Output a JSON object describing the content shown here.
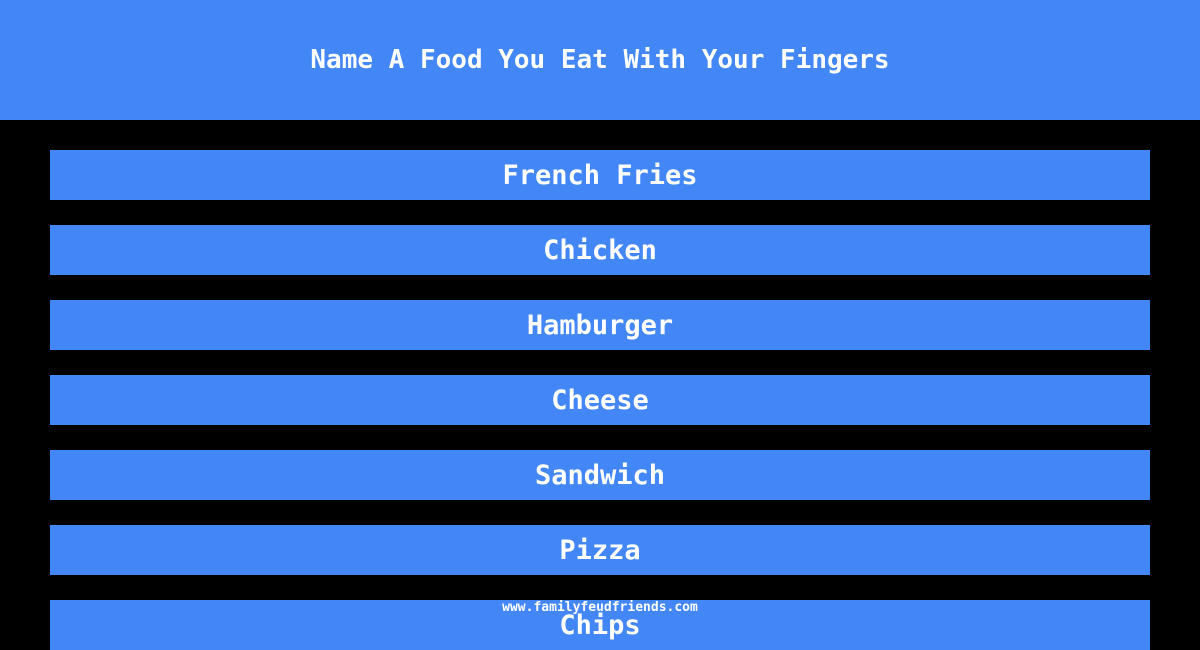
{
  "question": "Name A Food You Eat With Your Fingers",
  "answers": [
    {
      "label": "French Fries"
    },
    {
      "label": "Chicken"
    },
    {
      "label": "Hamburger"
    },
    {
      "label": "Cheese"
    },
    {
      "label": "Sandwich"
    },
    {
      "label": "Pizza"
    },
    {
      "label": "Chips"
    }
  ],
  "watermark": "www.familyfeudfriends.com",
  "colors": {
    "accent": "#4287f5",
    "background": "#000000",
    "text": "#ffffff"
  }
}
